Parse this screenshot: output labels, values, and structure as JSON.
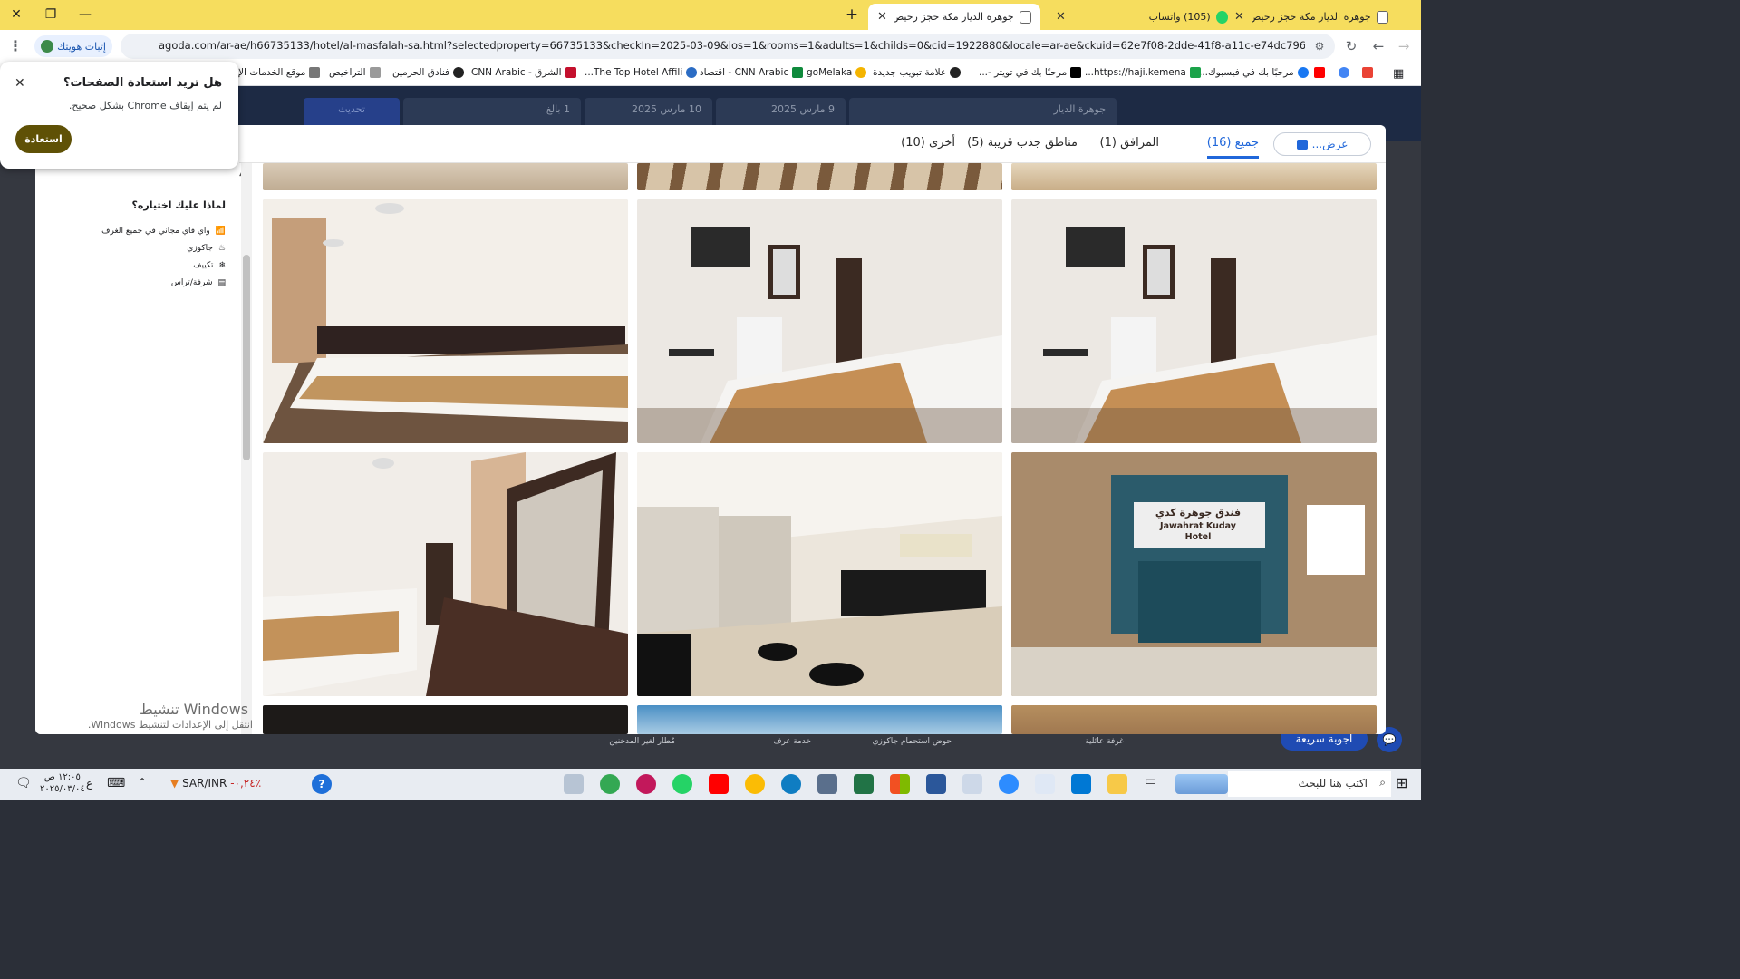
{
  "browser": {
    "tabs": [
      {
        "title": "جوهرة الديار مكة حجز رخيص فوري"
      },
      {
        "title": "(105) واتساب"
      },
      {
        "title": "جوهرة الديار مكة حجز رخيص فور"
      }
    ],
    "url": "agoda.com/ar-ae/h66735133/hotel/al-masfalah-sa.html?selectedproperty=66735133&checkIn=2025-03-09&los=1&rooms=1&adults=1&childs=0&cid=1922880&locale=ar-ae&ckuid=62e7f08-2dde-41f8-a11c-e74dc79683ec&prid=0&gclid=CjwKC...",
    "profile_label": "إثبات هويتك",
    "bookmarks": [
      "مرحبًا بك في فيسبوك...",
      "https://haji.kemena...",
      "مرحبًا بك في تويتر -...",
      "علامة تبويب جديدة",
      "goMelaka",
      "CNN Arabic - اقتصاد",
      "The Top Hotel Affili...",
      "الشرق - CNN Arabic",
      "فنادق الحرمين",
      "التراخيص",
      "موقع الخدمات الإ"
    ]
  },
  "restore_popup": {
    "title": "هل تريد استعادة الصفحات؟",
    "message": "لم يتم إيقاف Chrome بشكل صحيح.",
    "button": "استعادة"
  },
  "search_strip": {
    "query": "جوهرة الديار",
    "checkin": "9 مارس 2025",
    "checkout": "10 مارس 2025",
    "guests": "1 بالغ",
    "update": "تحديث"
  },
  "gallery": {
    "view_button": "عرض...",
    "tabs": [
      {
        "label": "جميع (16)"
      },
      {
        "label": "المرافق (1)"
      },
      {
        "label": "مناطق جذب قريبة (5)"
      },
      {
        "label": "أخرى (10)"
      }
    ],
    "why_title": "لماذا عليك اختياره؟",
    "features": [
      "واي فاي مجاني في جميع الغرف",
      "جاكوزي",
      "تكييف",
      "شرفة/تراس"
    ],
    "hotel_sign_ar": "فندق جوهرة كدي",
    "hotel_sign_en1": "Jawahrat Kuday",
    "hotel_sign_en2": "Hotel"
  },
  "behind_strip": [
    "غرفة عائلية",
    "حوض استحمام جاكوزي",
    "خدمة غرف",
    "مُطار لغير المدخنين"
  ],
  "chat_button": "أجوبة سريعة",
  "windows_watermark": {
    "line1": "تنشيط Windows",
    "line2": "انتقل إلى الإعدادات لتنشيط Windows."
  },
  "taskbar": {
    "search": "اكتب هنا للبحث",
    "currency": "SAR/INR",
    "change": "-٠,٢٤٪",
    "time": "١٢:٠٥ ص",
    "date": "٢٠٢٥/٠٣/٠٤",
    "lang": "ع"
  }
}
